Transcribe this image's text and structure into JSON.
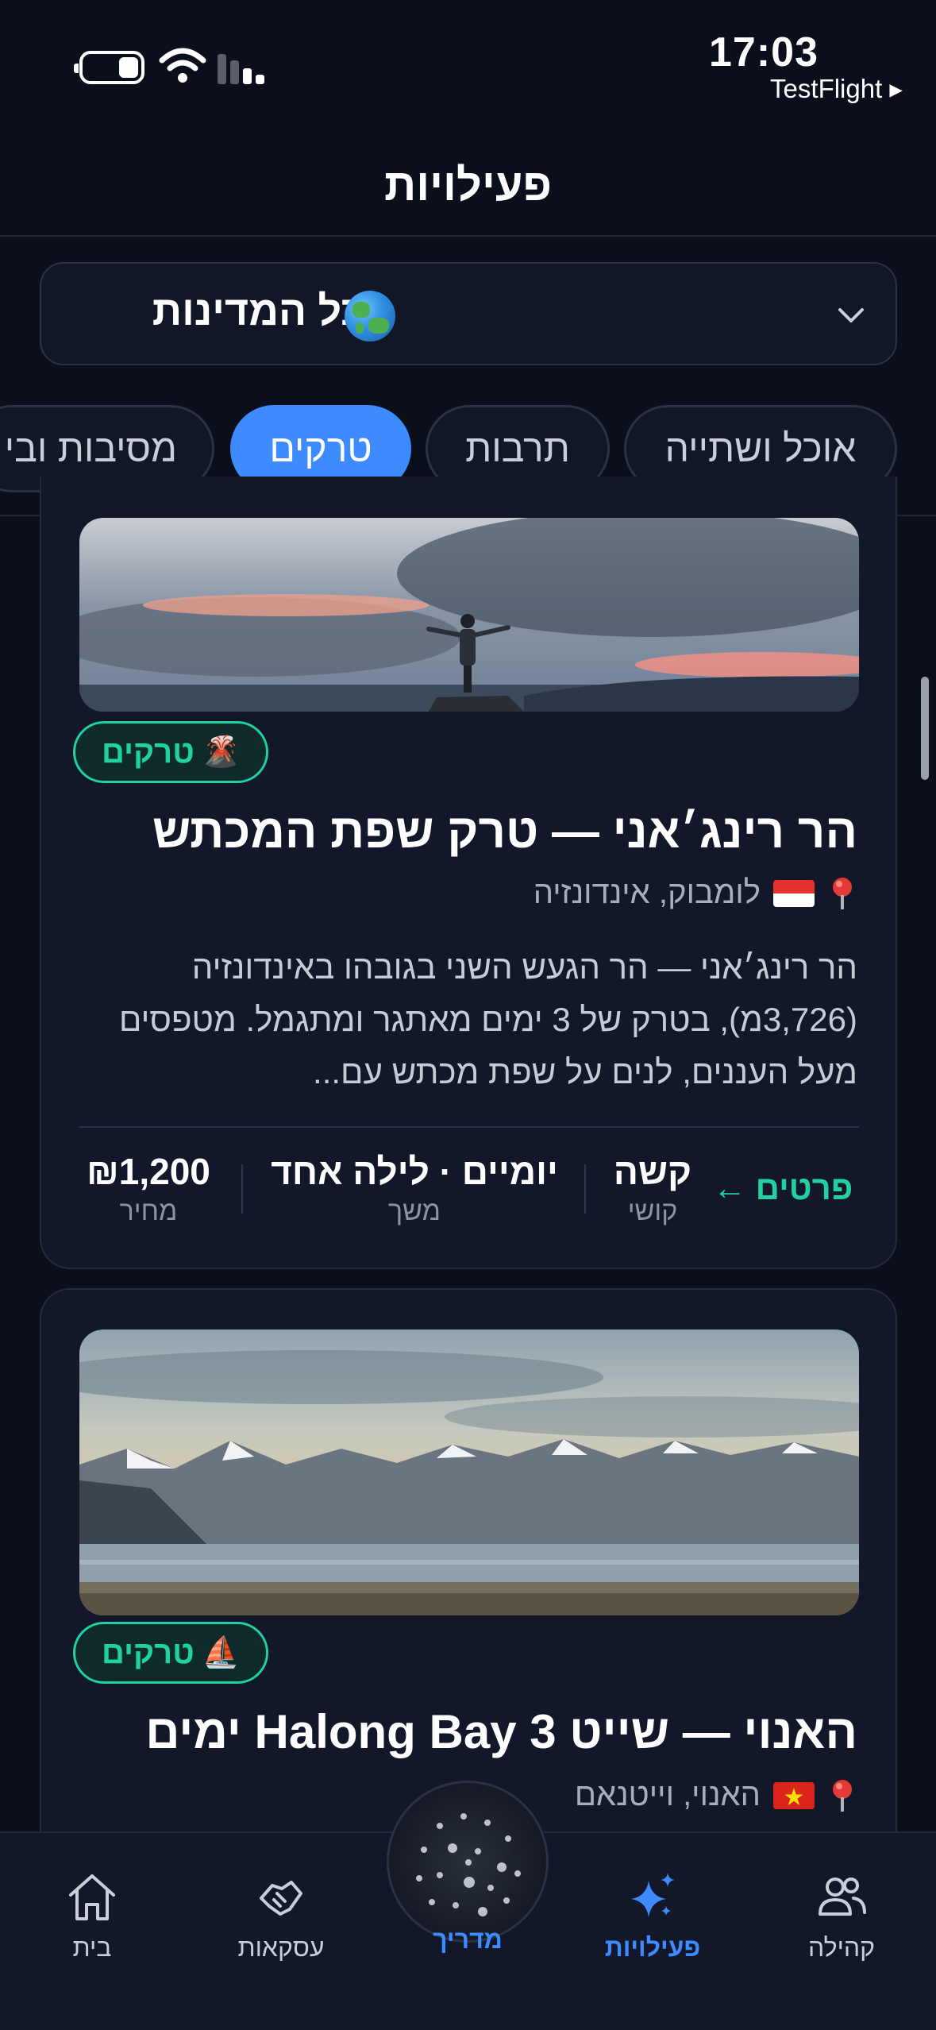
{
  "status_bar": {
    "time": "17:03",
    "back_app": "TestFlight ▸"
  },
  "header": {
    "title": "פעילויות"
  },
  "country_filter": {
    "label": "כל המדינות",
    "icon": "globe-icon"
  },
  "category_tabs": [
    {
      "label": "אוכל ושתייה",
      "active": false
    },
    {
      "label": "תרבות",
      "active": false
    },
    {
      "label": "טרקים",
      "active": true
    },
    {
      "label": "מסיבות ובי",
      "active": false
    }
  ],
  "cards": [
    {
      "badge": "טרקים",
      "badge_icon": "volcano-icon",
      "title": "הר רינג׳אני — טרק שפת המכתש",
      "location": "לומבוק, אינדונזיה",
      "flag": "indonesia-flag",
      "description": "הר רינג׳אני — הר הגעש השני בגובהו באינדונזיה (3,726מ), בטרק של 3 ימים מאתגר ומתגמל. מטפסים מעל העננים, לנים על שפת מכתש עם...",
      "details_label": "פרטים ←",
      "difficulty": {
        "value": "קשה",
        "label": "קושי"
      },
      "duration": {
        "value": "יומיים · לילה אחד",
        "label": "משך"
      },
      "price": {
        "value": "₪1,200",
        "label": "מחיר"
      }
    },
    {
      "badge": "טרקים",
      "badge_icon": "sailboat-icon",
      "title": "האנוי — שייט Halong Bay 3 ימים",
      "location": "האנוי, וייטנאם",
      "flag": "vietnam-flag"
    }
  ],
  "tab_bar": {
    "home": "בית",
    "deals": "עסקאות",
    "guide": "מדריך",
    "activities": "פעילויות",
    "community": "קהילה"
  },
  "colors": {
    "background": "#0b0f1c",
    "accent": "#3d8bff",
    "badge_green": "#1fd2a0"
  }
}
